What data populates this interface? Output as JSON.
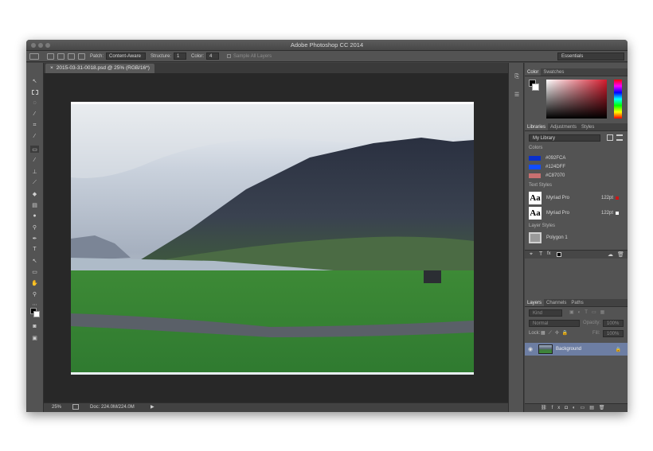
{
  "window": {
    "title": "Adobe Photoshop CC 2014"
  },
  "options_bar": {
    "patch_label": "Patch:",
    "patch_value": "Content-Aware",
    "structure_label": "Structure:",
    "structure_value": "1",
    "color_label": "Color:",
    "color_value": "4",
    "sample_all_layers_label": "Sample All Layers",
    "workspace": "Essentials"
  },
  "document": {
    "tab_label": "2015-03-31-0018.psd @ 25% (RGB/16*)"
  },
  "status_bar": {
    "zoom": "25%",
    "doc_info": "Doc: 224.0M/224.0M"
  },
  "color_panel": {
    "tabs": [
      "Color",
      "Swatches"
    ],
    "foreground": "#000000",
    "background": "#ffffff",
    "hue_accent": "#d41b2d"
  },
  "libraries_panel": {
    "tabs": [
      "Libraries",
      "Adjustments",
      "Styles"
    ],
    "library_name": "My Library",
    "colors_label": "Colors",
    "colors": [
      {
        "hex": "#092FCA",
        "label": "#092FCA"
      },
      {
        "hex": "#124DFF",
        "label": "#124DFF"
      },
      {
        "hex": "#C87070",
        "label": "#C87070"
      }
    ],
    "text_styles_label": "Text Styles",
    "text_styles": [
      {
        "font": "Myriad Pro",
        "size": "122pt",
        "color": "#c81818"
      },
      {
        "font": "Myriad Pro",
        "size": "122pt",
        "color": "#ffffff"
      }
    ],
    "layer_styles_label": "Layer Styles",
    "layer_styles": [
      {
        "name": "Polygon 1"
      }
    ]
  },
  "layers_panel": {
    "tabs": [
      "Layers",
      "Channels",
      "Paths"
    ],
    "filter_kind": "Kind",
    "blend_mode": "Normal",
    "opacity_label": "Opacity:",
    "opacity_value": "100%",
    "lock_label": "Lock:",
    "fill_label": "Fill:",
    "fill_value": "100%",
    "layers": [
      {
        "name": "Background",
        "visible": true,
        "locked": true
      }
    ]
  },
  "icons": {
    "tools": [
      "move-icon",
      "marquee-icon",
      "lasso-icon",
      "quick-select-icon",
      "crop-icon",
      "eyedropper-icon",
      "healing-brush-icon",
      "brush-icon",
      "clone-stamp-icon",
      "history-brush-icon",
      "eraser-icon",
      "gradient-icon",
      "blur-icon",
      "dodge-icon",
      "pen-icon",
      "type-icon",
      "path-select-icon",
      "rectangle-icon",
      "hand-icon",
      "zoom-icon"
    ]
  }
}
